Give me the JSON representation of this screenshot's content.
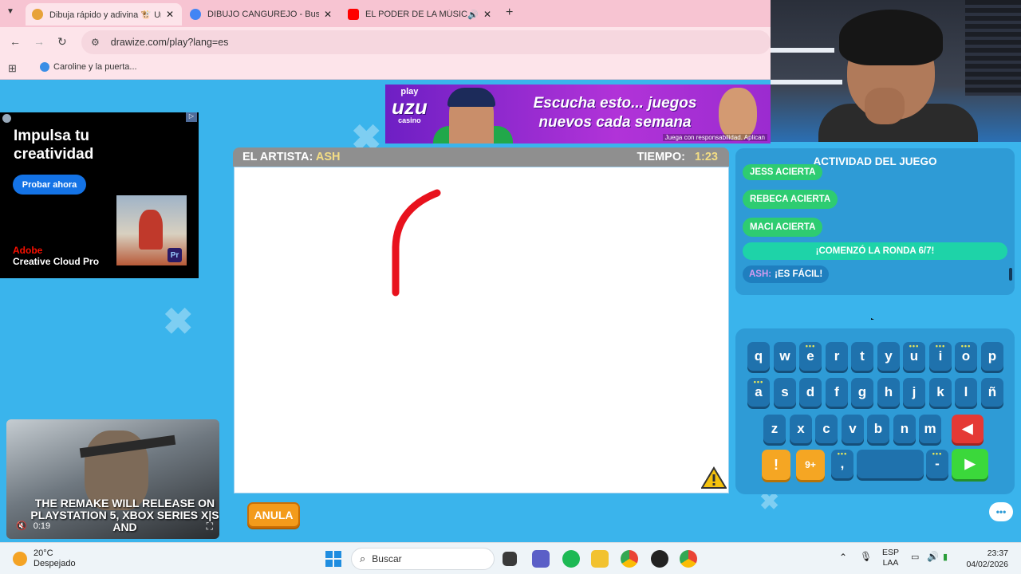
{
  "browser": {
    "tabs": [
      {
        "title": "Dibuja rápido y adivina 🐮 Un",
        "active": true,
        "favicon_color": "#e7a23a"
      },
      {
        "title": "DIBUJO CANGUREJO - Buscar c",
        "active": false,
        "favicon_color": "#4285f4"
      },
      {
        "title": "EL PODER DE LA MÚSICA E",
        "active": false,
        "favicon_color": "#ff0000"
      }
    ],
    "url": "drawize.com/play?lang=es",
    "bookmark": "Caroline y la puerta..."
  },
  "top_ad": {
    "logo_top": "play",
    "logo_main": "uzu",
    "logo_bottom": "casino",
    "headline_line1": "Escucha esto... juegos",
    "headline_line2": "nuevos cada semana",
    "disclaimer": "Juega con responsabilidad. Aplican"
  },
  "left_ad": {
    "headline_line1": "Impulsa tu",
    "headline_line2": "creatividad",
    "cta": "Probar ahora",
    "brand_line1": "Adobe",
    "brand_line2": "Creative Cloud Pro",
    "badge": "Pr"
  },
  "game": {
    "artist_label": "EL ARTISTA:",
    "artist_name": "ASH",
    "time_label": "TIEMPO:",
    "time_value": "1:23",
    "undo_button": "ANULA",
    "accent_color": "#f39b1b",
    "stroke_color": "#e8121d"
  },
  "activity": {
    "title": "ACTIVIDAD DEL JUEGO",
    "messages": [
      "JESS ACIERTA",
      "REBECA ACIERTA",
      "MACI ACIERTA"
    ],
    "round": "¡COMENZÓ LA RONDA 6/7!",
    "chat_user": "ASH:",
    "chat_text": "¡ES FÁCIL!"
  },
  "keyboard": {
    "row1": [
      "q",
      "w",
      "e",
      "r",
      "t",
      "y",
      "u",
      "i",
      "o",
      "p"
    ],
    "row2": [
      "a",
      "s",
      "d",
      "f",
      "g",
      "h",
      "j",
      "k",
      "l",
      "ñ"
    ],
    "row3": [
      "z",
      "x",
      "c",
      "v",
      "b",
      "n",
      "m"
    ],
    "accent_keys": [
      "e",
      "u",
      "i",
      "o",
      "a"
    ],
    "comma": ",",
    "dash": "-",
    "hint_badge": "9+",
    "back_icon": "◀",
    "go_icon": "▶"
  },
  "video": {
    "caption": "THE REMAKE WILL RELEASE ON PLAYSTATION 5, XBOX SERIES X|S AND",
    "time": "0:19"
  },
  "taskbar": {
    "temperature": "20°C",
    "weather": "Despejado",
    "search": "Buscar",
    "lang_top": "ESP",
    "lang_bottom": "LAA",
    "time": "23:37",
    "date": "04/02/2026"
  }
}
